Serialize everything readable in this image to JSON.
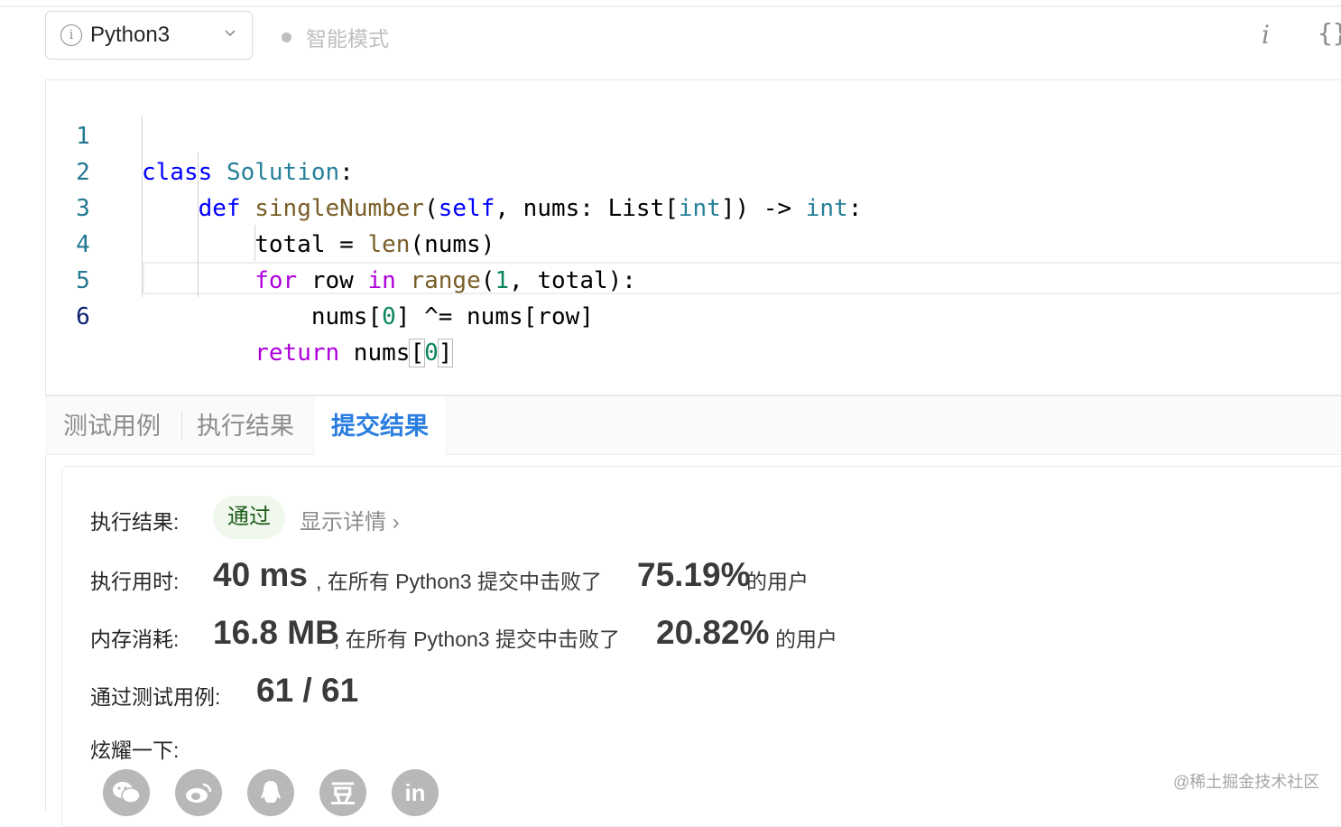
{
  "toolbar": {
    "language": "Python3",
    "mode_label": "智能模式",
    "info_button": "i",
    "format_button": "{}"
  },
  "editor": {
    "line_numbers": [
      "1",
      "2",
      "3",
      "4",
      "5",
      "6"
    ],
    "lines": [
      "class Solution:",
      "    def singleNumber(self, nums: List[int]) -> int:",
      "        total = len(nums)",
      "        for row in range(1, total):",
      "            nums[0] ^= nums[row]",
      "        return nums[0]"
    ]
  },
  "tabs": {
    "test_cases": "测试用例",
    "run_result": "执行结果",
    "submit_result": "提交结果"
  },
  "result": {
    "status_label": "执行结果:",
    "status_value": "通过",
    "details_link": "显示详情 ›",
    "time_label": "执行用时:",
    "time_value": "40 ms",
    "time_text": ", 在所有 Python3 提交中击败了",
    "time_percent": "75.19%",
    "time_suffix": "的用户",
    "memory_label": "内存消耗:",
    "memory_value": "16.8 MB",
    "memory_text": ", 在所有 Python3 提交中击败了",
    "memory_percent": "20.82%",
    "memory_suffix": "的用户",
    "cases_label": "通过测试用例:",
    "cases_value": "61 / 61",
    "share_label": "炫耀一下:"
  },
  "share_icons": [
    "wechat-icon",
    "weibo-icon",
    "qq-icon",
    "douban-icon",
    "linkedin-icon"
  ],
  "share_glyphs": {
    "douban": "豆",
    "linkedin": "in"
  },
  "watermark": "@稀土掘金技术社区",
  "colors": {
    "accent_blue": "#2a7ee0",
    "pass_green_bg": "#f0f8ee",
    "pass_green_text": "#1d5c1a",
    "keyword": "#0000ff",
    "class_name": "#267f99",
    "function": "#795e26",
    "control": "#af00db",
    "number": "#098658"
  }
}
